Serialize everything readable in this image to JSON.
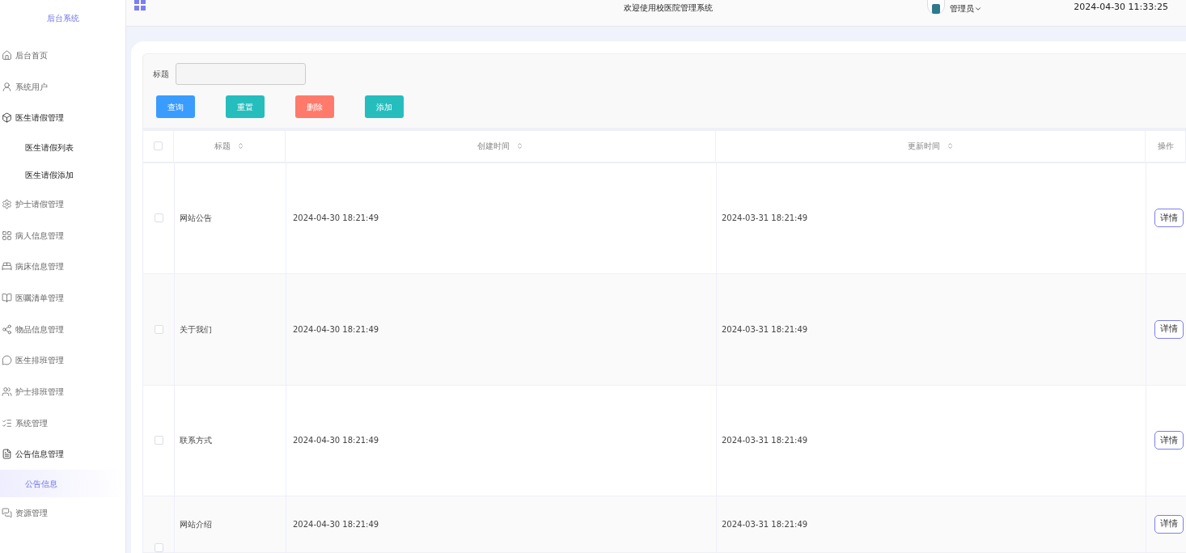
{
  "sidebar": {
    "title": "后台系统",
    "items": [
      {
        "label": "后台首页",
        "expanded": false
      },
      {
        "label": "系统用户",
        "expanded": false
      },
      {
        "label": "医生请假管理",
        "expanded": true,
        "children": [
          {
            "label": "医生请假列表",
            "selected": false
          },
          {
            "label": "医生请假添加",
            "selected": false
          }
        ]
      },
      {
        "label": "护士请假管理",
        "expanded": false
      },
      {
        "label": "病人信息管理",
        "expanded": false
      },
      {
        "label": "病床信息管理",
        "expanded": false
      },
      {
        "label": "医嘱清单管理",
        "expanded": false
      },
      {
        "label": "物品信息管理",
        "expanded": false
      },
      {
        "label": "医生排班管理",
        "expanded": false
      },
      {
        "label": "护士排班管理",
        "expanded": false
      },
      {
        "label": "系统管理",
        "expanded": false
      },
      {
        "label": "公告信息管理",
        "expanded": true,
        "children": [
          {
            "label": "公告信息",
            "selected": true
          }
        ]
      },
      {
        "label": "资源管理",
        "expanded": false
      }
    ]
  },
  "header": {
    "welcome": "欢迎使用校医院管理系统",
    "user": "管理员",
    "datetime": "2024-04-30 11:33:25"
  },
  "search": {
    "label": "标题"
  },
  "buttons": [
    {
      "label": "查询",
      "kind": "query"
    },
    {
      "label": "重置",
      "kind": "reset"
    },
    {
      "label": "删除",
      "kind": "delete"
    },
    {
      "label": "添加",
      "kind": "add"
    }
  ],
  "table": {
    "select_all": {
      "checked": false
    },
    "columns": [
      "标题",
      "创建时间",
      "更新时间",
      "操作"
    ],
    "rows": [
      {
        "checked": false,
        "title": "网站公告",
        "created": "2024-04-30 18:21:49",
        "updated": "2024-03-31 18:21:49",
        "action": "详情"
      },
      {
        "checked": false,
        "title": "关于我们",
        "created": "2024-04-30 18:21:49",
        "updated": "2024-03-31 18:21:49",
        "action": "详情"
      },
      {
        "checked": false,
        "title": "联系方式",
        "created": "2024-04-30 18:21:49",
        "updated": "2024-03-31 18:21:49",
        "action": "详情"
      },
      {
        "checked": false,
        "title": "网站介绍",
        "created": "2024-04-30 18:21:49",
        "updated": "2024-03-31 18:21:49",
        "action": "详情"
      }
    ]
  }
}
